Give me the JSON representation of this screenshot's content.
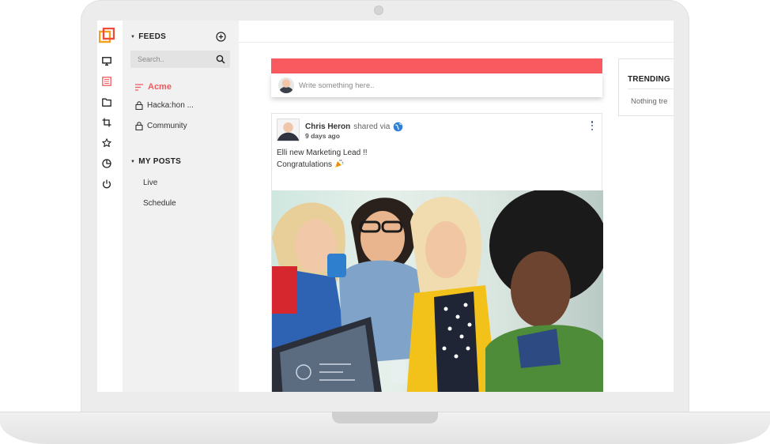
{
  "sidebar": {
    "feeds_heading": "FEEDS",
    "search_placeholder": "Search..",
    "feeds": [
      {
        "label": "Acme",
        "icon": "sort-lines-icon",
        "active": true
      },
      {
        "label": "Hacka:hon ...",
        "icon": "lock-icon",
        "active": false
      },
      {
        "label": "Community",
        "icon": "lock-icon",
        "active": false
      }
    ],
    "posts_heading": "MY POSTS",
    "posts": [
      "Live",
      "Schedule"
    ]
  },
  "rail": {
    "icons": [
      "monitor-icon",
      "newspaper-icon",
      "folder-icon",
      "crop-icon",
      "star-icon",
      "pie-chart-icon",
      "power-icon"
    ]
  },
  "composer": {
    "placeholder": "Write something here.."
  },
  "post": {
    "author": "Chris Heron",
    "shared_via": "shared via",
    "time": "9 days ago",
    "text_line1": "Elli new Marketing Lead !!",
    "text_line2": "Congratulations"
  },
  "trending": {
    "title": "TRENDING",
    "empty": "Nothing tre"
  },
  "colors": {
    "accent": "#f25a5f",
    "banner": "#f85a5f",
    "logo_orange": "#f4a01c",
    "logo_red": "#ee4b3b",
    "rail_active": "#f25a5f"
  }
}
